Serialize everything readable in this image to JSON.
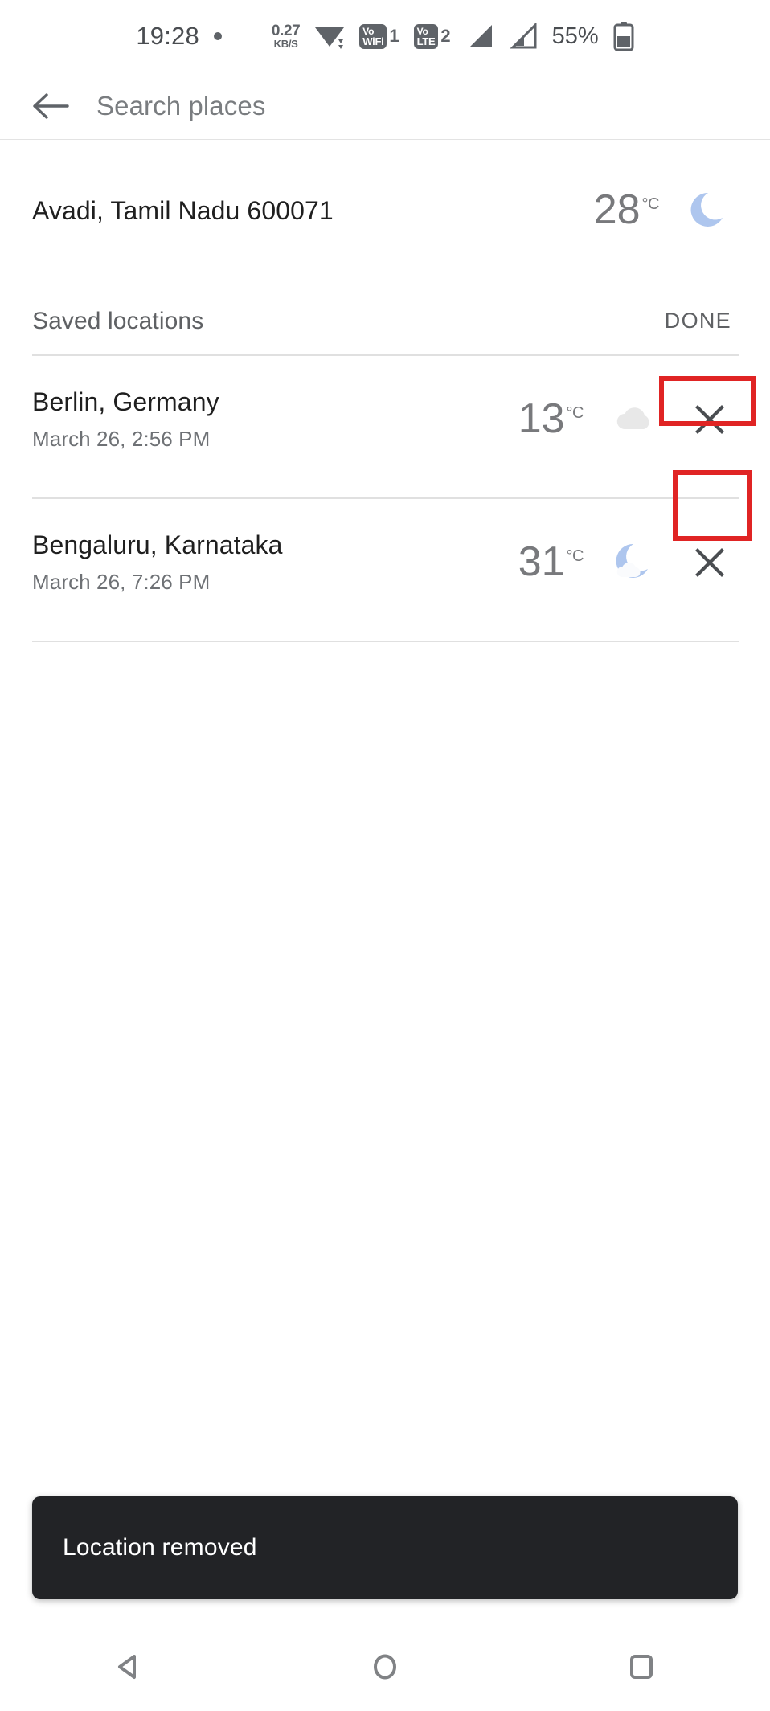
{
  "status_bar": {
    "time": "19:28",
    "network_speed_value": "0.27",
    "network_speed_unit": "KB/S",
    "wifi_icon": "wifi-icon",
    "vowifi_label_top": "Vo",
    "vowifi_label_bottom": "WiFi",
    "vowifi_sim": "1",
    "volte_label_top": "Vo",
    "volte_label_bottom": "LTE",
    "volte_sim": "2",
    "signal_1_icon": "signal-bars-icon",
    "signal_2_icon": "signal-bars-icon",
    "battery_percent": "55%",
    "battery_icon": "battery-icon"
  },
  "appbar": {
    "back_icon": "back-arrow-icon",
    "search_placeholder": "Search places",
    "search_value": ""
  },
  "current_location": {
    "name": "Avadi, Tamil Nadu 600071",
    "temperature": "28",
    "unit": "°C",
    "weather_icon": "crescent-moon-icon"
  },
  "saved_section": {
    "title": "Saved locations",
    "done_label": "DONE"
  },
  "saved_locations": [
    {
      "name": "Berlin, Germany",
      "time": "March 26, 2:56 PM",
      "temperature": "13",
      "unit": "°C",
      "weather_icon": "cloud-icon",
      "remove_icon": "close-x-icon"
    },
    {
      "name": "Bengaluru, Karnataka",
      "time": "March 26, 7:26 PM",
      "temperature": "31",
      "unit": "°C",
      "weather_icon": "moon-behind-cloud-icon",
      "remove_icon": "close-x-icon"
    }
  ],
  "snackbar": {
    "message": "Location removed"
  },
  "navbar": {
    "back_icon": "nav-back-triangle-icon",
    "home_icon": "nav-home-circle-icon",
    "recents_icon": "nav-recents-square-icon"
  },
  "annotations": {
    "highlight_color": "#e02424",
    "done_button_box": "DONE",
    "remove_button_box": "close-x-icon"
  },
  "colors": {
    "background": "#ffffff",
    "primary_text": "#1f1f1f",
    "secondary_text": "#6e7175",
    "temp_text": "#78797c",
    "divider": "#e0e0e0",
    "snackbar_bg": "#222326",
    "moon_blue": "#aec6ee",
    "cloud_gray": "#e8e8e8"
  }
}
